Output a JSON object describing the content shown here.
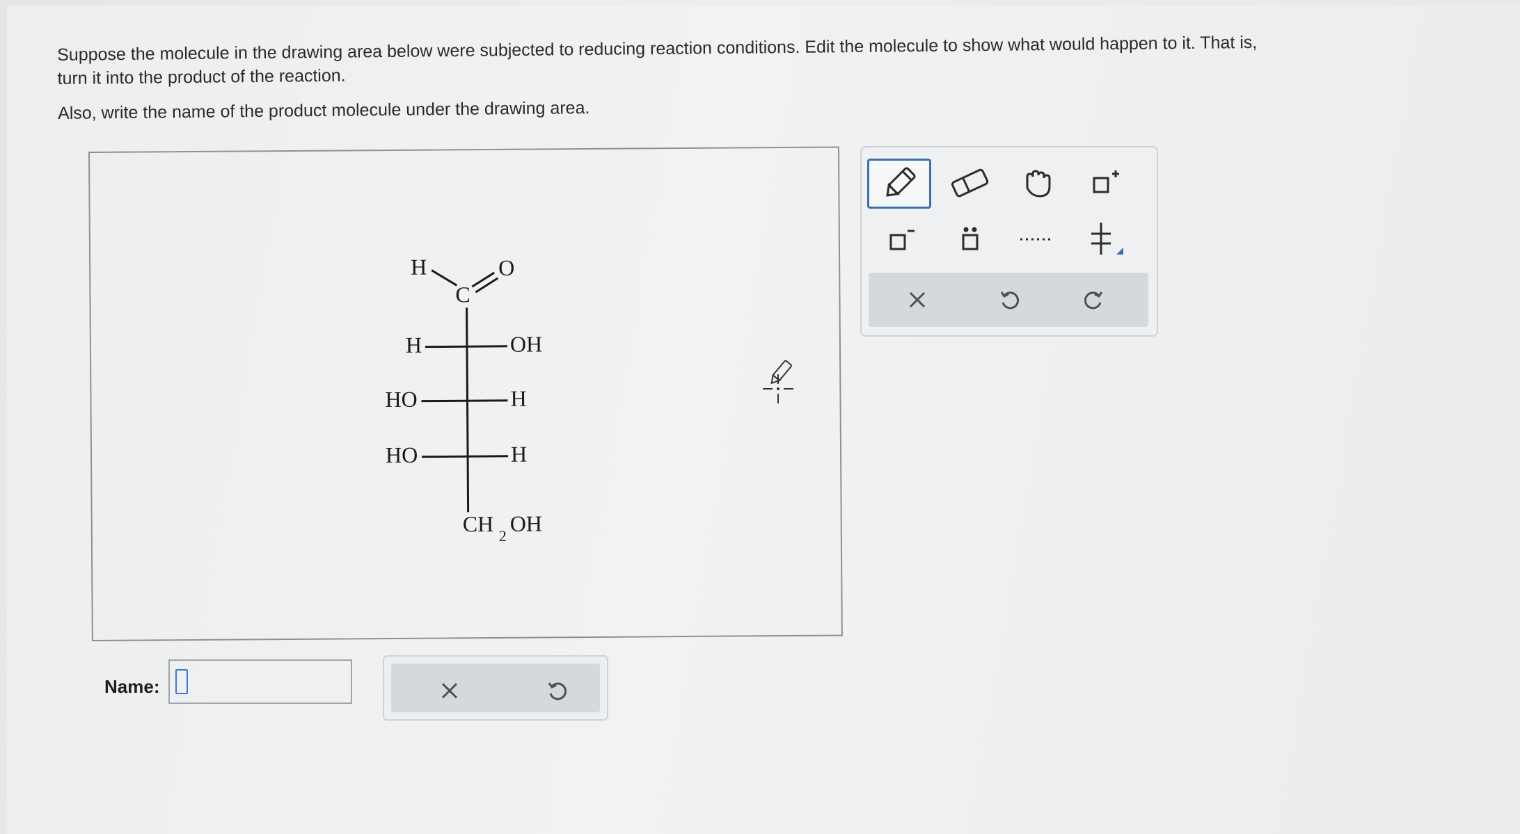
{
  "question": {
    "line1": "Suppose the molecule in the drawing area below were subjected to reducing reaction conditions. Edit the molecule to show what would happen to it. That is,",
    "line2": "turn it into the product of the reaction.",
    "line3": "Also, write the name of the product molecule under the drawing area."
  },
  "molecule": {
    "aldehyde_h": "H",
    "aldehyde_c": "C",
    "aldehyde_o": "O",
    "row1_left": "H",
    "row1_right": "OH",
    "row2_left": "HO",
    "row2_right": "H",
    "row3_left": "HO",
    "row3_right": "H",
    "bottom_ch": "CH",
    "bottom_sub": "2",
    "bottom_oh": "OH"
  },
  "name_field": {
    "label": "Name:",
    "value": ""
  },
  "bottom_actions": {
    "clear_icon": "x-icon",
    "undo_icon": "undo-icon"
  },
  "toolbox": {
    "tools": [
      "pencil-icon",
      "eraser-icon",
      "hand-icon",
      "positive-charge-icon",
      "negative-charge-icon",
      "lone-pair-icon",
      "radical-dots-icon",
      "stereo-bond-icon"
    ],
    "actions": [
      "x-icon",
      "undo-icon",
      "redo-icon"
    ],
    "selected_color": "#3b6fb0"
  }
}
